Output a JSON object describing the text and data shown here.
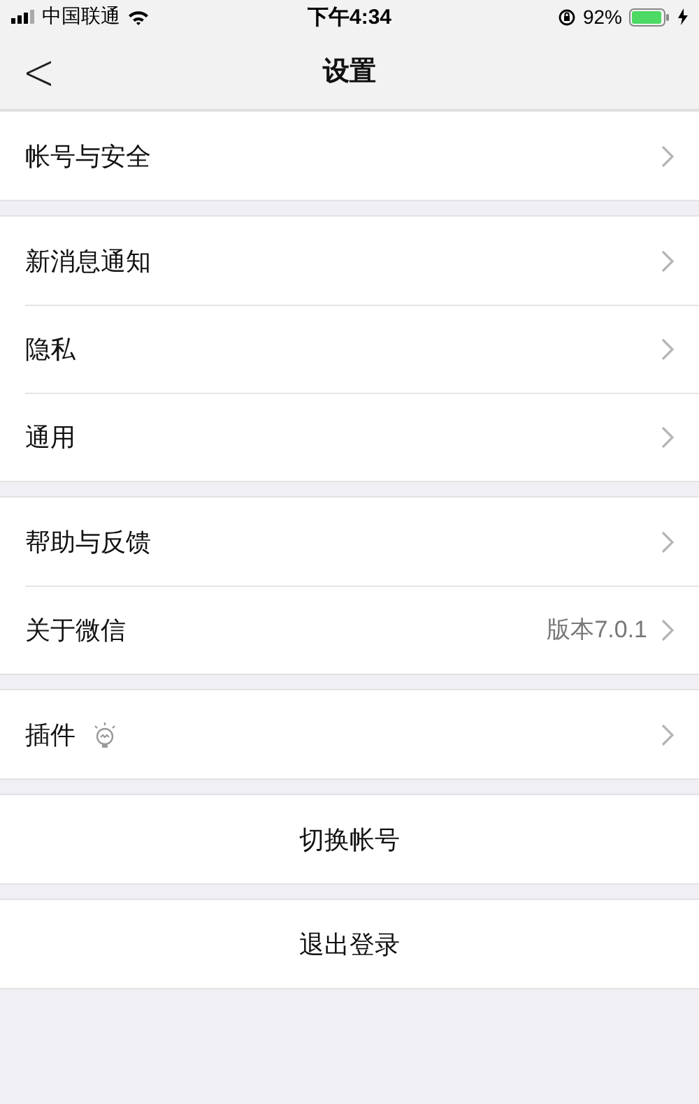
{
  "status_bar": {
    "carrier": "中国联通",
    "time": "下午4:34",
    "battery": "92%"
  },
  "nav": {
    "back": "<",
    "title": "设置"
  },
  "groups": [
    {
      "items": [
        {
          "kind": "link",
          "label": "帐号与安全"
        }
      ]
    },
    {
      "items": [
        {
          "kind": "link",
          "label": "新消息通知"
        },
        {
          "kind": "link",
          "label": "隐私"
        },
        {
          "kind": "link",
          "label": "通用"
        }
      ]
    },
    {
      "items": [
        {
          "kind": "link",
          "label": "帮助与反馈"
        },
        {
          "kind": "link",
          "label": "关于微信",
          "value": "版本7.0.1"
        }
      ]
    },
    {
      "items": [
        {
          "kind": "link-bulb",
          "label": "插件"
        }
      ]
    },
    {
      "items": [
        {
          "kind": "action",
          "label": "切换帐号"
        }
      ]
    },
    {
      "items": [
        {
          "kind": "action",
          "label": "退出登录"
        }
      ]
    }
  ]
}
